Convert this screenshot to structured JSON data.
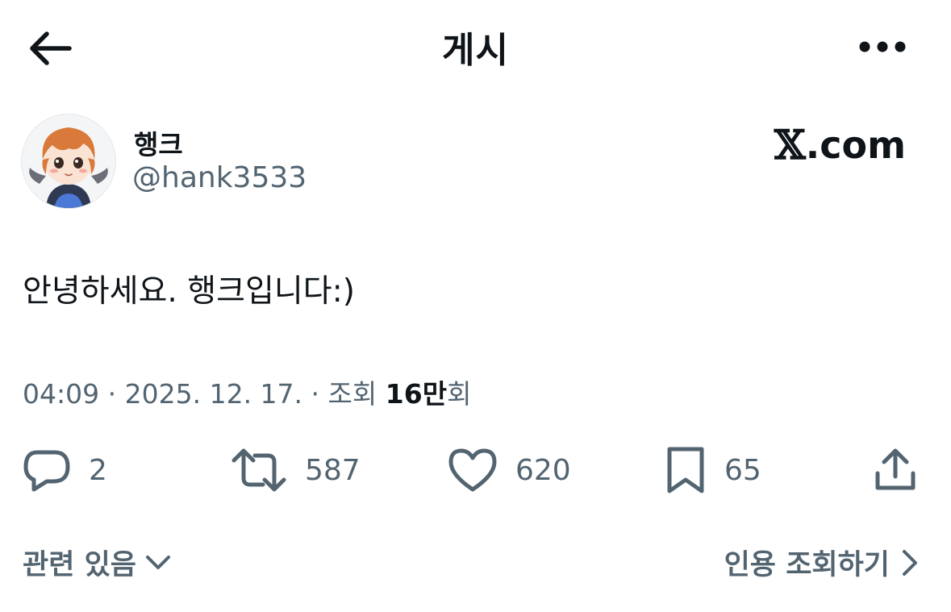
{
  "header": {
    "title": "게시"
  },
  "author": {
    "display_name": "행크",
    "handle": "@hank3533",
    "watermark_x": "𝕏",
    "watermark_domain": ".com"
  },
  "post": {
    "text": "안녕하세요. 행크입니다:)",
    "time": "04:09",
    "date": "2025. 12. 17.",
    "views_prefix": "조회",
    "views_count": "16만",
    "views_suffix": "회",
    "separator": "·"
  },
  "actions": {
    "replies": "2",
    "reposts": "587",
    "likes": "620",
    "bookmarks": "65"
  },
  "footer": {
    "related_label": "관련 있음",
    "quotes_label": "인용 조회하기"
  },
  "icons": {
    "back": "arrow-left-icon",
    "more": "more-dots-icon",
    "reply": "reply-bubble-icon",
    "repost": "repost-icon",
    "like": "heart-icon",
    "bookmark": "bookmark-icon",
    "share": "share-icon",
    "chevron_down": "chevron-down-icon",
    "chevron_right": "chevron-right-icon"
  },
  "colors": {
    "text_primary": "#0f1419",
    "text_secondary": "#536471",
    "background": "#ffffff"
  }
}
